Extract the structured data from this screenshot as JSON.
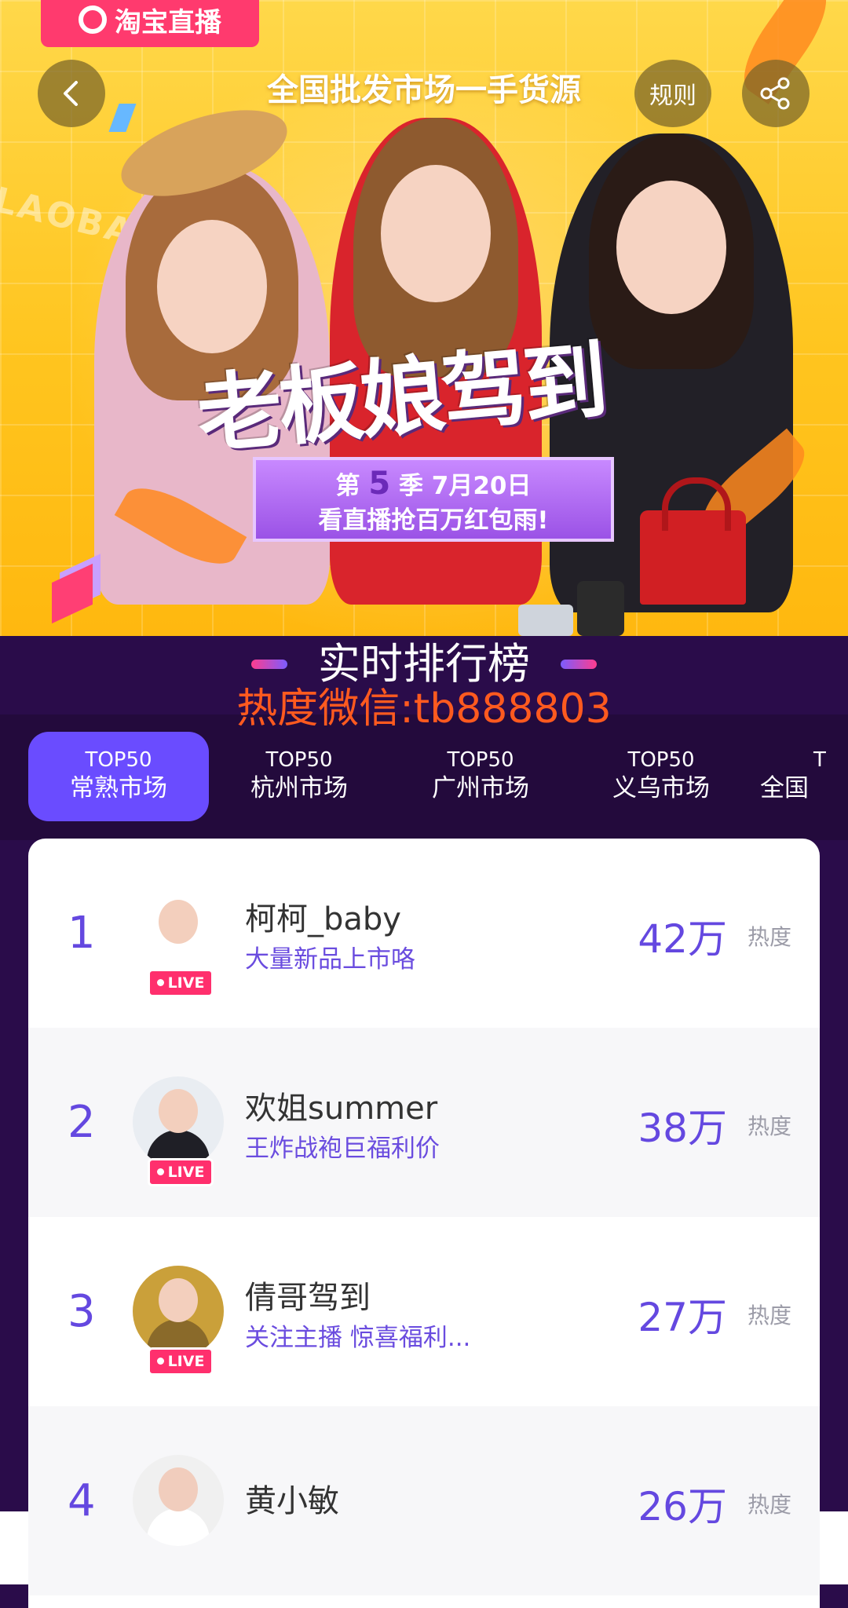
{
  "banner": {
    "app_logo": "淘宝直播",
    "headline": "全国批发市场一手货源",
    "watermark": "LAOBAN",
    "title": "老板娘驾到",
    "season_prefix": "第",
    "season_num": "5",
    "season_suffix": "季  7月20日",
    "season_line2": "看直播抢百万红包雨!",
    "rules_label": "规则",
    "back_icon": "chevron-left-icon",
    "share_icon": "share-icon"
  },
  "ranking": {
    "title": "实时排行榜",
    "wechat": "热度微信:tb888803"
  },
  "tabs": [
    {
      "top": "TOP50",
      "label": "常熟市场",
      "active": true
    },
    {
      "top": "TOP50",
      "label": "杭州市场",
      "active": false
    },
    {
      "top": "TOP50",
      "label": "广州市场",
      "active": false
    },
    {
      "top": "TOP50",
      "label": "义乌市场",
      "active": false
    },
    {
      "top": "T",
      "label": "全国",
      "active": false
    }
  ],
  "list": [
    {
      "rank": "1",
      "name": "柯柯_baby",
      "desc": "大量新品上市咯",
      "heat": "42万",
      "heat_label": "热度",
      "live": "LIVE",
      "avatar_color": "#d8d8d8"
    },
    {
      "rank": "2",
      "name": "欢姐summer",
      "desc": "王炸战袍巨福利价",
      "heat": "38万",
      "heat_label": "热度",
      "live": "LIVE",
      "avatar_color": "#2d2f3a"
    },
    {
      "rank": "3",
      "name": "倩哥驾到",
      "desc": "关注主播 惊喜福利...",
      "heat": "27万",
      "heat_label": "热度",
      "live": "LIVE",
      "avatar_color": "#c99a2a"
    },
    {
      "rank": "4",
      "name": "黄小敏",
      "desc": "",
      "heat": "26万",
      "heat_label": "热度",
      "avatar_color": "#e8e8e8"
    }
  ]
}
